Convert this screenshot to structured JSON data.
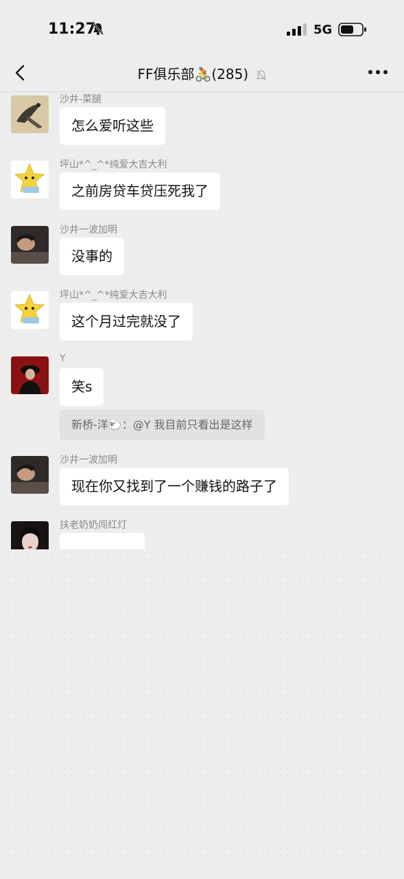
{
  "status_bar": {
    "time": "11:27",
    "network": "5G"
  },
  "nav": {
    "title": "FF俱乐部🚴(285)"
  },
  "messages": [
    {
      "sender": "沙井-菜腿",
      "text": "怎么爱听这些",
      "avatar": "bird-painting-avatar"
    },
    {
      "sender": "坪山*^_^*纯爱大吉大利",
      "text": "之前房贷车贷压死我了",
      "avatar": "yellow-star-avatar"
    },
    {
      "sender": "沙井一波加明",
      "text": "没事的",
      "avatar": "sleeping-man-avatar"
    },
    {
      "sender": "坪山*^_^*纯爱大吉大利",
      "text": "这个月过完就没了",
      "avatar": "yellow-star-avatar"
    },
    {
      "sender": "Y",
      "text": "笑s",
      "avatar": "woman-red-background-avatar"
    },
    {
      "sender": "沙井一波加明",
      "text": "现在你又找到了一个赚钱的路子了",
      "avatar": "sleeping-man-avatar"
    },
    {
      "sender": "扶老奶奶闯红灯",
      "text": "",
      "avatar": "woman-portrait-avatar"
    }
  ],
  "quote": {
    "text": "新桥-洋🐑：@Y 我目前只看出是这样"
  },
  "colors": {
    "background": "#ededed",
    "bubble": "#ffffff",
    "sender_text": "#8a8a8a"
  }
}
